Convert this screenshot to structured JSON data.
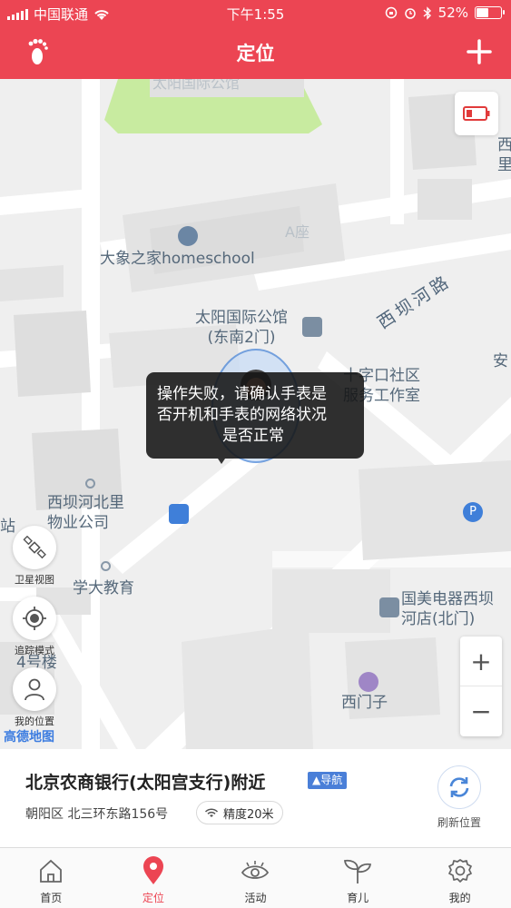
{
  "status_bar": {
    "carrier": "中国联通",
    "time": "下午1:55",
    "battery": "52%",
    "battery_level": 0.52
  },
  "nav": {
    "title": "定位"
  },
  "map": {
    "labels": {
      "top_building": "太阳国际公馆",
      "a_building": "A座",
      "elephant": "大象之家homeschool",
      "gate_line1": "太阳国际公馆",
      "gate_line2": "(东南2门)",
      "road": "西坝河路",
      "community_line1": "十字口社区",
      "community_line2": "服务工作室",
      "xibahebeili_line1": "西坝河北里",
      "xibahebeili_line2": "物业公司",
      "xuedajiaoyu": "学大教育",
      "bldg4": "4号楼",
      "gome_line1": "国美电器西坝",
      "gome_line2": "河店(北门)",
      "ximenzi": "西门子",
      "zhan": "站",
      "right_edge1": "西",
      "right_edge2": "里",
      "right_edge3": "安"
    },
    "tools": {
      "satellite": "卫星视图",
      "tracking": "追踪模式",
      "my_location": "我的位置"
    },
    "zoom_in": "+",
    "zoom_out": "−",
    "provider": "高德地图",
    "toast": {
      "line1": "操作失败，请确认手表是",
      "line2": "否开机和手表的网络状况",
      "line3": "是否正常"
    }
  },
  "location": {
    "name": "北京农商银行(太阳宫支行)附近",
    "nav_badge": "▲导航",
    "address": "朝阳区 北三环东路156号",
    "accuracy": "精度20米",
    "refresh": "刷新位置"
  },
  "tabs": [
    {
      "label": "首页",
      "icon": "home-icon"
    },
    {
      "label": "定位",
      "icon": "location-pin-icon"
    },
    {
      "label": "活动",
      "icon": "eye-icon"
    },
    {
      "label": "育儿",
      "icon": "sprout-icon"
    },
    {
      "label": "我的",
      "icon": "gear-icon"
    }
  ],
  "colors": {
    "brand_red": "#ec4553",
    "accent_blue": "#4a7fd8",
    "park_green": "#c8eba0"
  }
}
